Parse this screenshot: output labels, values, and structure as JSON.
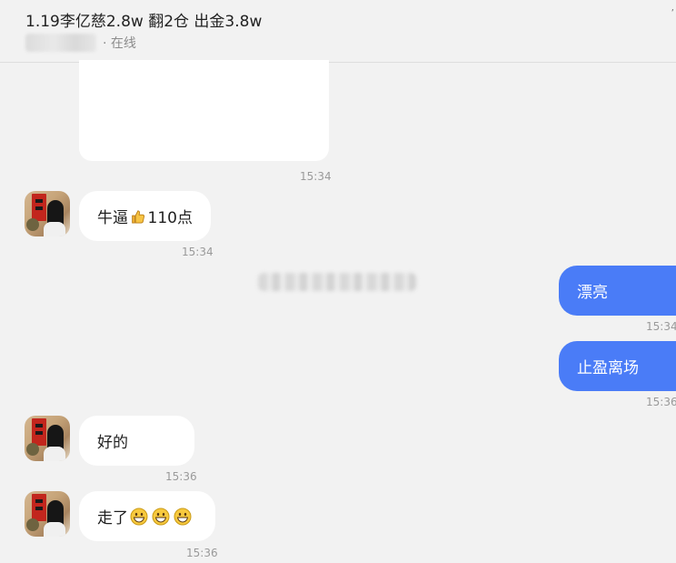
{
  "header": {
    "title": "1.19李亿慈2.8w 翻2仓 出金3.8w",
    "status": "· 在线"
  },
  "messages": [
    {
      "time": "15:34"
    },
    {
      "text_pre": "牛逼",
      "emoji": "thumbs-up-icon",
      "text_post": "110点",
      "time": "15:34"
    },
    {
      "text": "漂亮",
      "time": "15:34"
    },
    {
      "text": "止盈离场",
      "time": "15:36"
    },
    {
      "text": "好的",
      "time": "15:36"
    },
    {
      "text": "走了",
      "emojis": [
        "grinning-face-icon",
        "grinning-face-icon",
        "grinning-face-icon"
      ],
      "time": "15:36"
    }
  ],
  "colors": {
    "background": "#f2f2f2",
    "incoming_bubble": "#ffffff",
    "outgoing_bubble": "#4a7cf7",
    "timestamp": "#9a9a9a"
  }
}
